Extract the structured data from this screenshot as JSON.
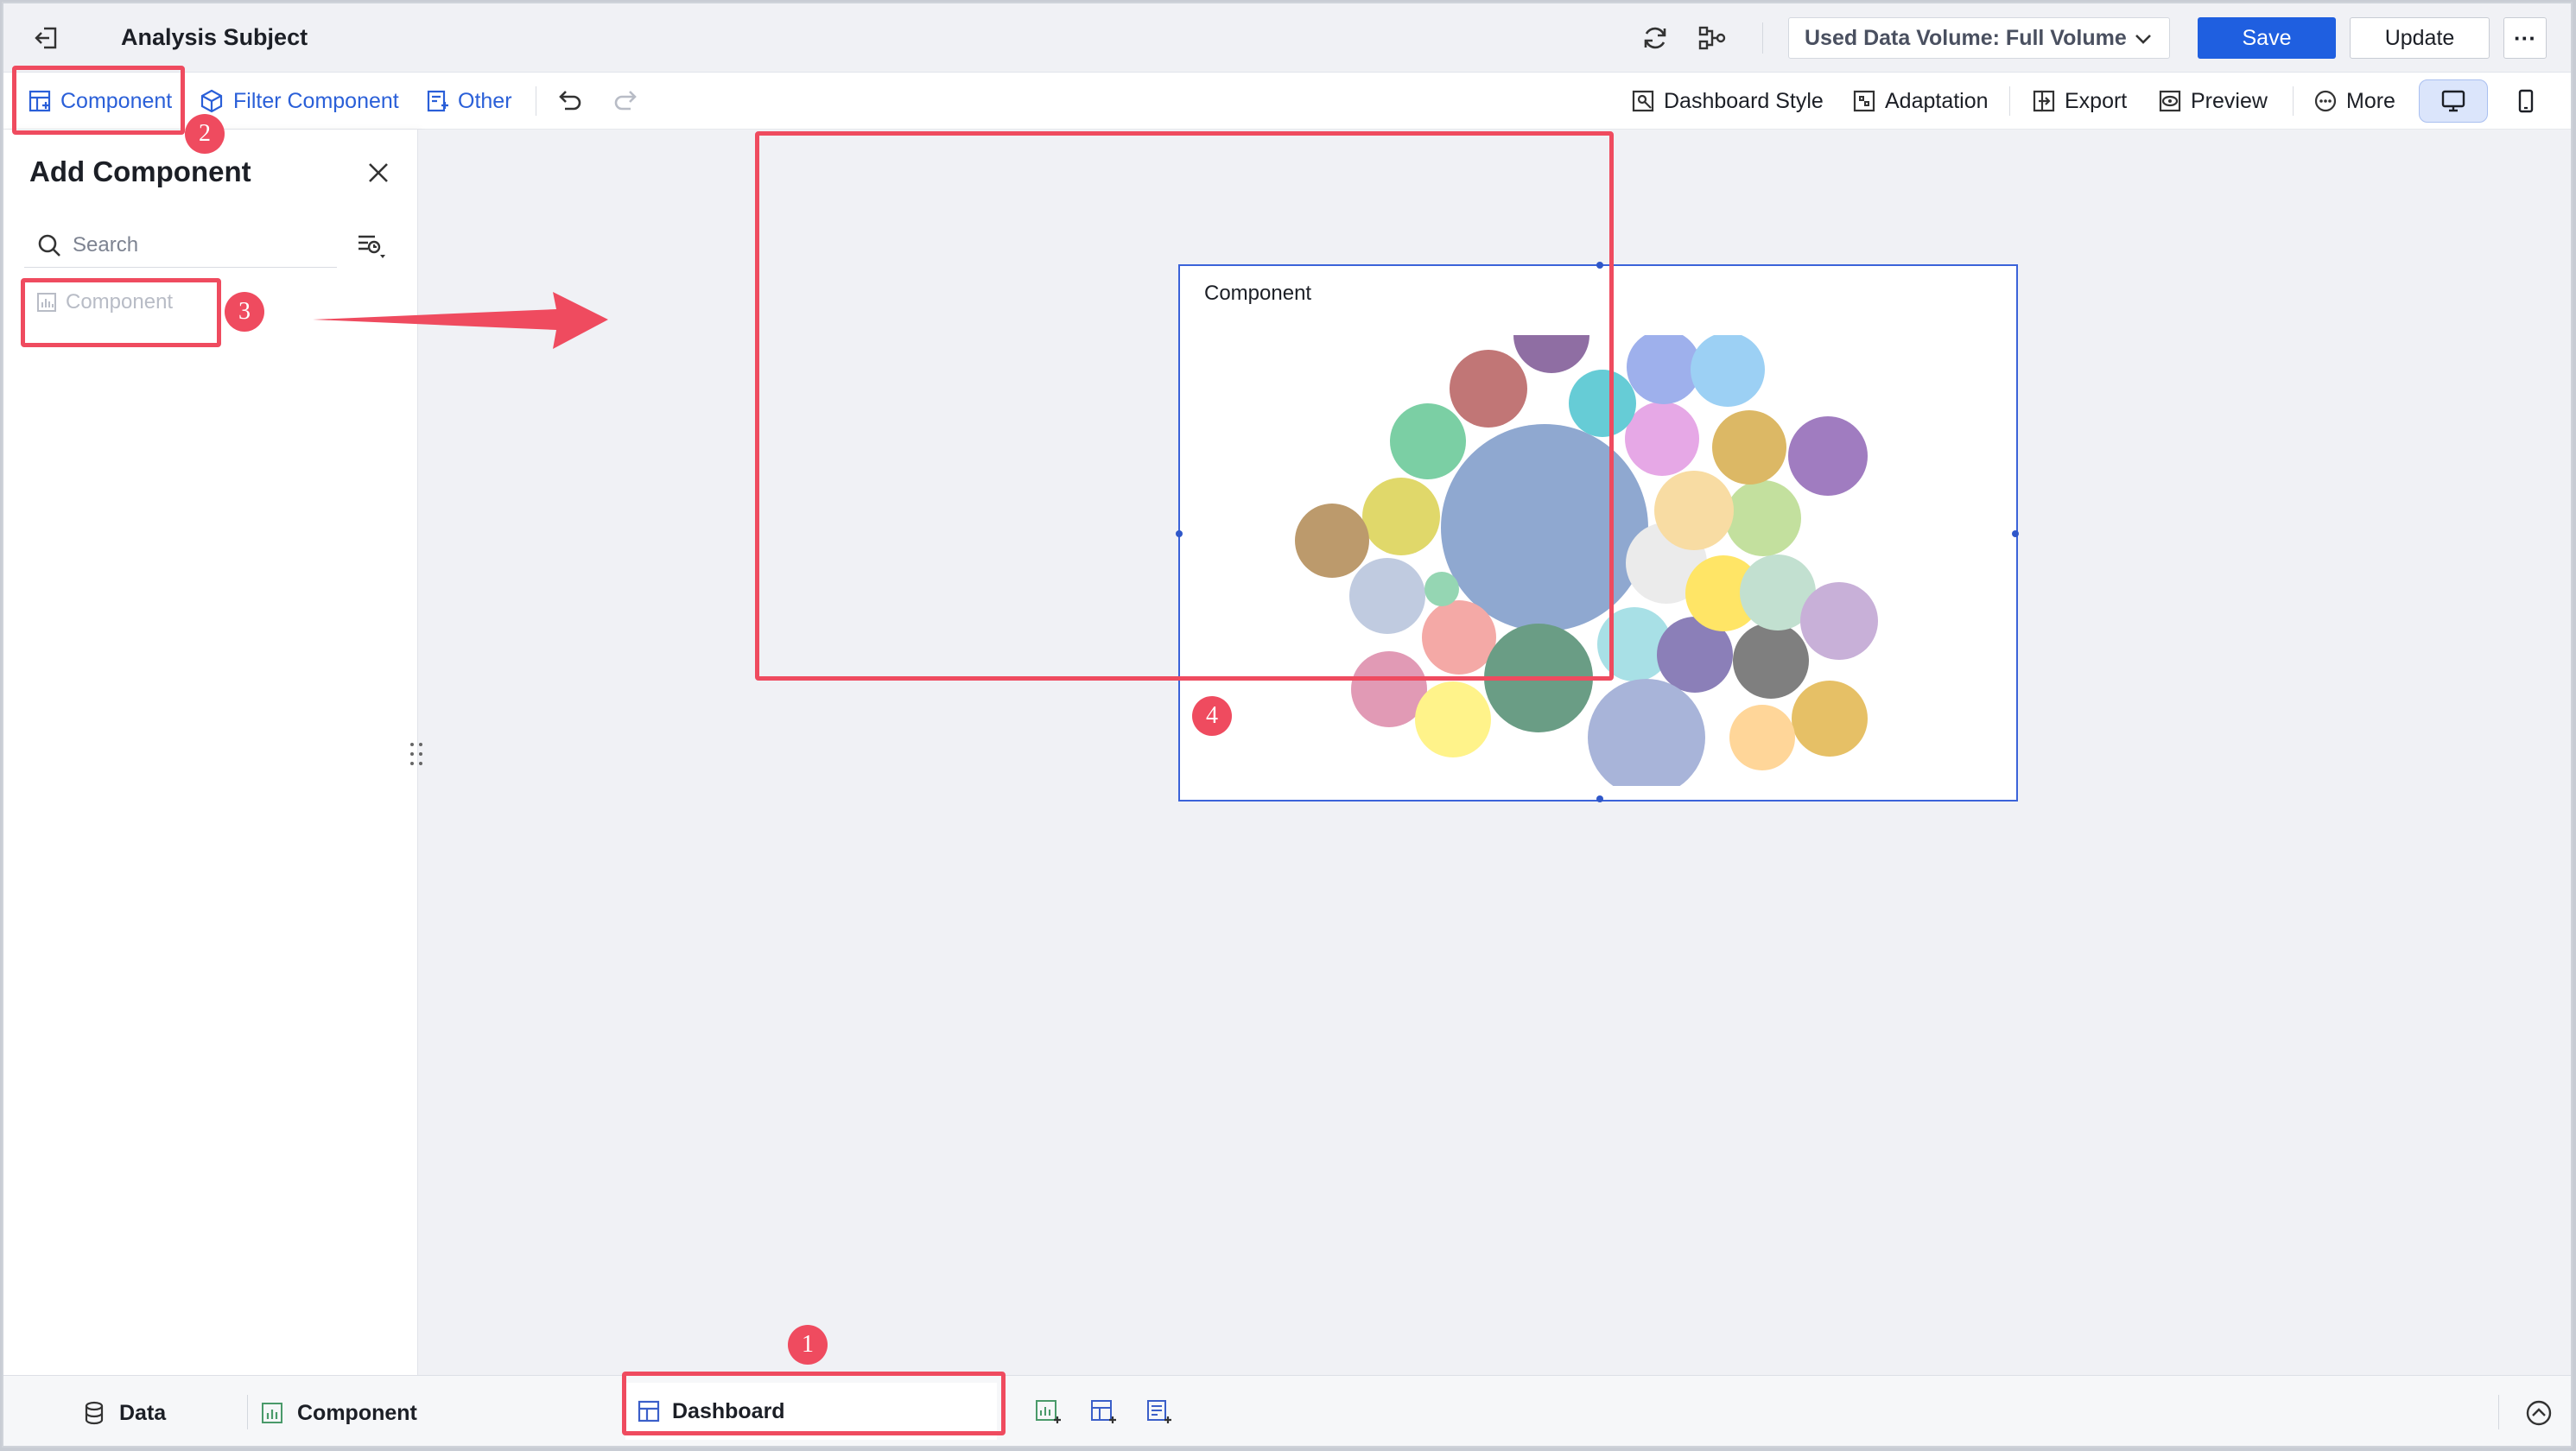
{
  "header": {
    "title": "Analysis Subject",
    "volume_select": "Used Data Volume: Full Volume",
    "save_label": "Save",
    "update_label": "Update",
    "more_dots": "···"
  },
  "toolbar": {
    "component": "Component",
    "filter_component": "Filter Component",
    "other": "Other",
    "dashboard_style": "Dashboard Style",
    "adaptation": "Adaptation",
    "export": "Export",
    "preview": "Preview",
    "more": "More"
  },
  "panel": {
    "title": "Add Component",
    "search_placeholder": "Search",
    "item_label": "Component"
  },
  "widget": {
    "title": "Component"
  },
  "chart_data": {
    "type": "bubble",
    "title": "Component",
    "legend": "none",
    "axes": "none",
    "bubble_colors": [
      "#8fa8d0",
      "#c17676",
      "#7bcfa4",
      "#e0d86a",
      "#bc9a6c",
      "#c0cbe0",
      "#f4a9a6",
      "#e19ab5",
      "#fff38a",
      "#6a9d85",
      "#a8e0e6",
      "#8b7fb8",
      "#7f7f7f",
      "#e6c066",
      "#ffd699",
      "#a8b4d9",
      "#ebebeb",
      "#ffe566",
      "#c2e0d0",
      "#c8b0d8",
      "#c3e09e",
      "#f8dca3",
      "#a07cc0",
      "#dcb865",
      "#e6a8e6",
      "#9eb0ec",
      "#9cd0f4",
      "#66ccd6",
      "#8f6ea3"
    ]
  },
  "bottombar": {
    "data": "Data",
    "component": "Component",
    "dashboard": "Dashboard"
  },
  "annotations": [
    "1",
    "2",
    "3",
    "4"
  ],
  "colors": {
    "accent": "#1f5fe0",
    "annotation": "#ef4b5f",
    "selection": "#3b63d9"
  }
}
